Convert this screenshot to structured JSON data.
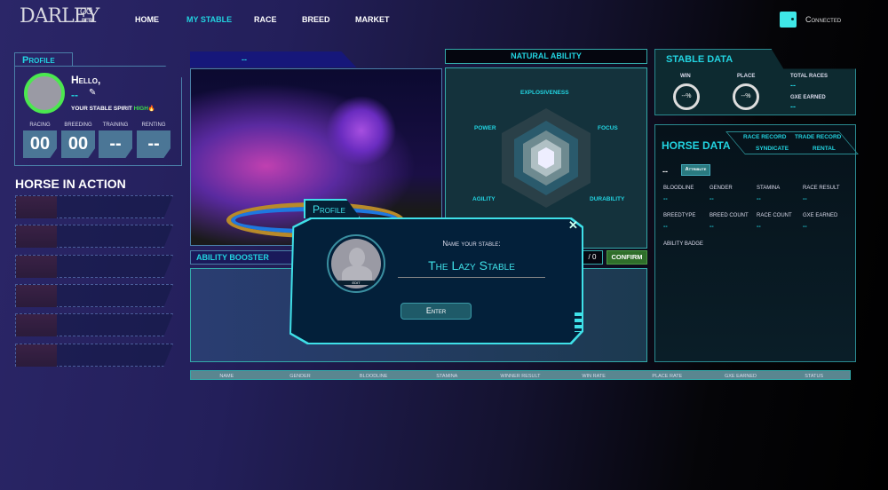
{
  "header": {
    "logo": "DARLEY",
    "logo_go": "GO",
    "logo_beta": "BETA",
    "nav": [
      "HOME",
      "MY STABLE",
      "RACE",
      "BREED",
      "MARKET"
    ],
    "active": "MY STABLE",
    "wallet_status": "Connected"
  },
  "profile": {
    "tab": "Profile",
    "hello": "Hello,",
    "name": "--",
    "spirit_label": "YOUR STABLE SPIRIT",
    "spirit_value": "HIGH",
    "stats": [
      {
        "label": "RACING",
        "value": "00"
      },
      {
        "label": "BREEDING",
        "value": "00"
      },
      {
        "label": "TRAINING",
        "value": "--"
      },
      {
        "label": "RENTING",
        "value": "--"
      }
    ]
  },
  "horse_in_action": {
    "title": "HORSE IN ACTION",
    "rows": 6
  },
  "viewer": {
    "title": "--"
  },
  "natural_ability": {
    "title": "NATURAL ABILITY",
    "axes": [
      "EXPLOSIVENESS",
      "POWER",
      "FOCUS",
      "AGILITY",
      "DURABILITY"
    ]
  },
  "ability_booster": {
    "title": "ABILITY BOOSTER",
    "points": "/ 0",
    "confirm": "CONFIRM"
  },
  "stable_data": {
    "title": "STABLE DATA",
    "win_label": "WIN",
    "win": "--%",
    "place_label": "PLACE",
    "place": "--%",
    "total_races_label": "TOTAL RACES",
    "total_races": "--",
    "gxe_label": "GXE EARNED",
    "gxe": "--"
  },
  "horse_data": {
    "title": "HORSE DATA",
    "tabs": [
      "RACE RECORD",
      "TRADE RECORD",
      "SYNDICATE",
      "RENTAL"
    ],
    "name": "--",
    "attribute": "Attribute",
    "fields": [
      {
        "label": "BLOODLINE",
        "value": "--"
      },
      {
        "label": "GENDER",
        "value": "--"
      },
      {
        "label": "STAMINA",
        "value": "--"
      },
      {
        "label": "RACE RESULT",
        "value": "--"
      },
      {
        "label": "BREEDTYPE",
        "value": "--"
      },
      {
        "label": "BREED COUNT",
        "value": "--"
      },
      {
        "label": "RACE COUNT",
        "value": "--"
      },
      {
        "label": "GXE EARNED",
        "value": "--"
      }
    ],
    "ability_badge": "ABILITY BADGE"
  },
  "table": {
    "columns": [
      "NAME",
      "GENDER",
      "BLOODLINE",
      "STAMINA",
      "WINNER RESULT",
      "WIN RATE",
      "PLACE RATE",
      "GXE EARNED",
      "STATUS"
    ]
  },
  "modal": {
    "tab": "Profile",
    "prompt": "Name your stable:",
    "input_value": "The Lazy Stable",
    "edit": "EDIT",
    "enter": "Enter"
  },
  "colors": {
    "accent": "#22d3e0",
    "active_nav": "#22d3e0",
    "spirit": "#3ddc4a",
    "confirm": "#2f6e2a"
  }
}
